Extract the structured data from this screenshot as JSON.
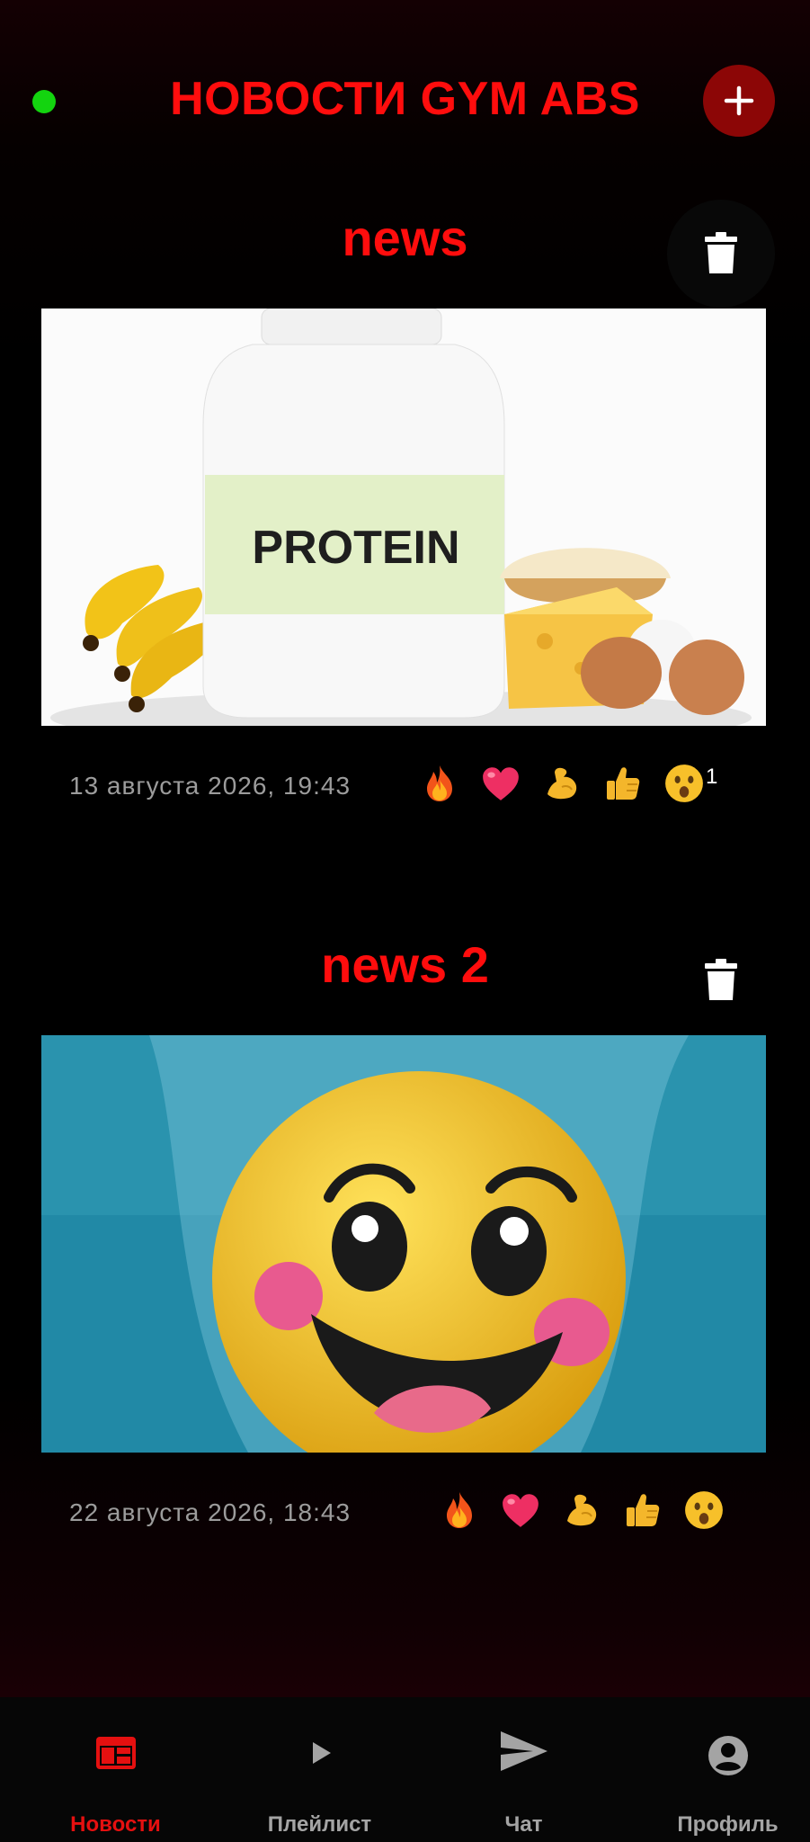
{
  "header": {
    "title": "НОВОСТИ GYM ABS"
  },
  "posts": [
    {
      "title": "news",
      "date": "13 августа 2026, 19:43",
      "image_text": "PROTEIN",
      "reactions": [
        {
          "icon": "fire-icon",
          "count": ""
        },
        {
          "icon": "heart-icon",
          "count": ""
        },
        {
          "icon": "flexed-biceps-icon",
          "count": ""
        },
        {
          "icon": "thumbs-up-icon",
          "count": ""
        },
        {
          "icon": "surprised-face-icon",
          "count": "1"
        }
      ]
    },
    {
      "title": "news 2",
      "date": "22 августа 2026, 18:43",
      "reactions": [
        {
          "icon": "fire-icon",
          "count": ""
        },
        {
          "icon": "heart-icon",
          "count": ""
        },
        {
          "icon": "flexed-biceps-icon",
          "count": ""
        },
        {
          "icon": "thumbs-up-icon",
          "count": ""
        },
        {
          "icon": "surprised-face-icon",
          "count": ""
        }
      ]
    }
  ],
  "nav": [
    {
      "label": "Новости",
      "icon": "news-icon",
      "active": true
    },
    {
      "label": "Плейлист",
      "icon": "play-icon",
      "active": false
    },
    {
      "label": "Чат",
      "icon": "send-icon",
      "active": false
    },
    {
      "label": "Профиль",
      "icon": "account-circle-icon",
      "active": false
    }
  ],
  "colors": {
    "accent": "#ff0d0d",
    "status_online": "#13d40f",
    "add_button": "#8c0606",
    "nav_active": "#e51010",
    "date_text": "#9c9c9c"
  }
}
